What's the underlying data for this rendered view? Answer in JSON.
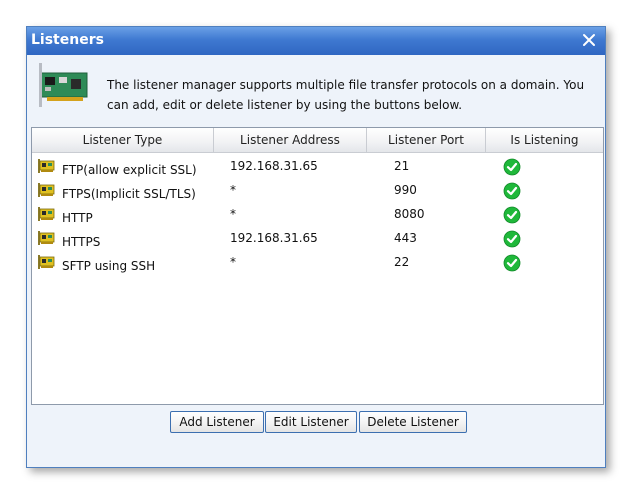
{
  "window": {
    "title": "Listeners",
    "close_icon": "close-icon",
    "accent_color": "#3f79d1"
  },
  "banner": {
    "icon": "network-card-icon",
    "description": "The listener manager supports multiple file transfer protocols on a domain. You can add, edit or delete listener by using the buttons below."
  },
  "table": {
    "columns": [
      "Listener Type",
      "Listener Address",
      "Listener Port",
      "Is Listening"
    ],
    "rows": [
      {
        "type": "FTP(allow explicit SSL)",
        "address": "192.168.31.65",
        "port": "21",
        "listening": true
      },
      {
        "type": "FTPS(Implicit SSL/TLS)",
        "address": "*",
        "port": "990",
        "listening": true
      },
      {
        "type": "HTTP",
        "address": "*",
        "port": "8080",
        "listening": true
      },
      {
        "type": "HTTPS",
        "address": "192.168.31.65",
        "port": "443",
        "listening": true
      },
      {
        "type": "SFTP using SSH",
        "address": "*",
        "port": "22",
        "listening": true
      }
    ],
    "row_icon": "network-card-icon",
    "listening_icon": "green-check-icon",
    "listening_color": "#1fb83a"
  },
  "buttons": {
    "add_label": "Add Listener",
    "edit_label": "Edit Listener",
    "delete_label": "Delete Listener"
  }
}
